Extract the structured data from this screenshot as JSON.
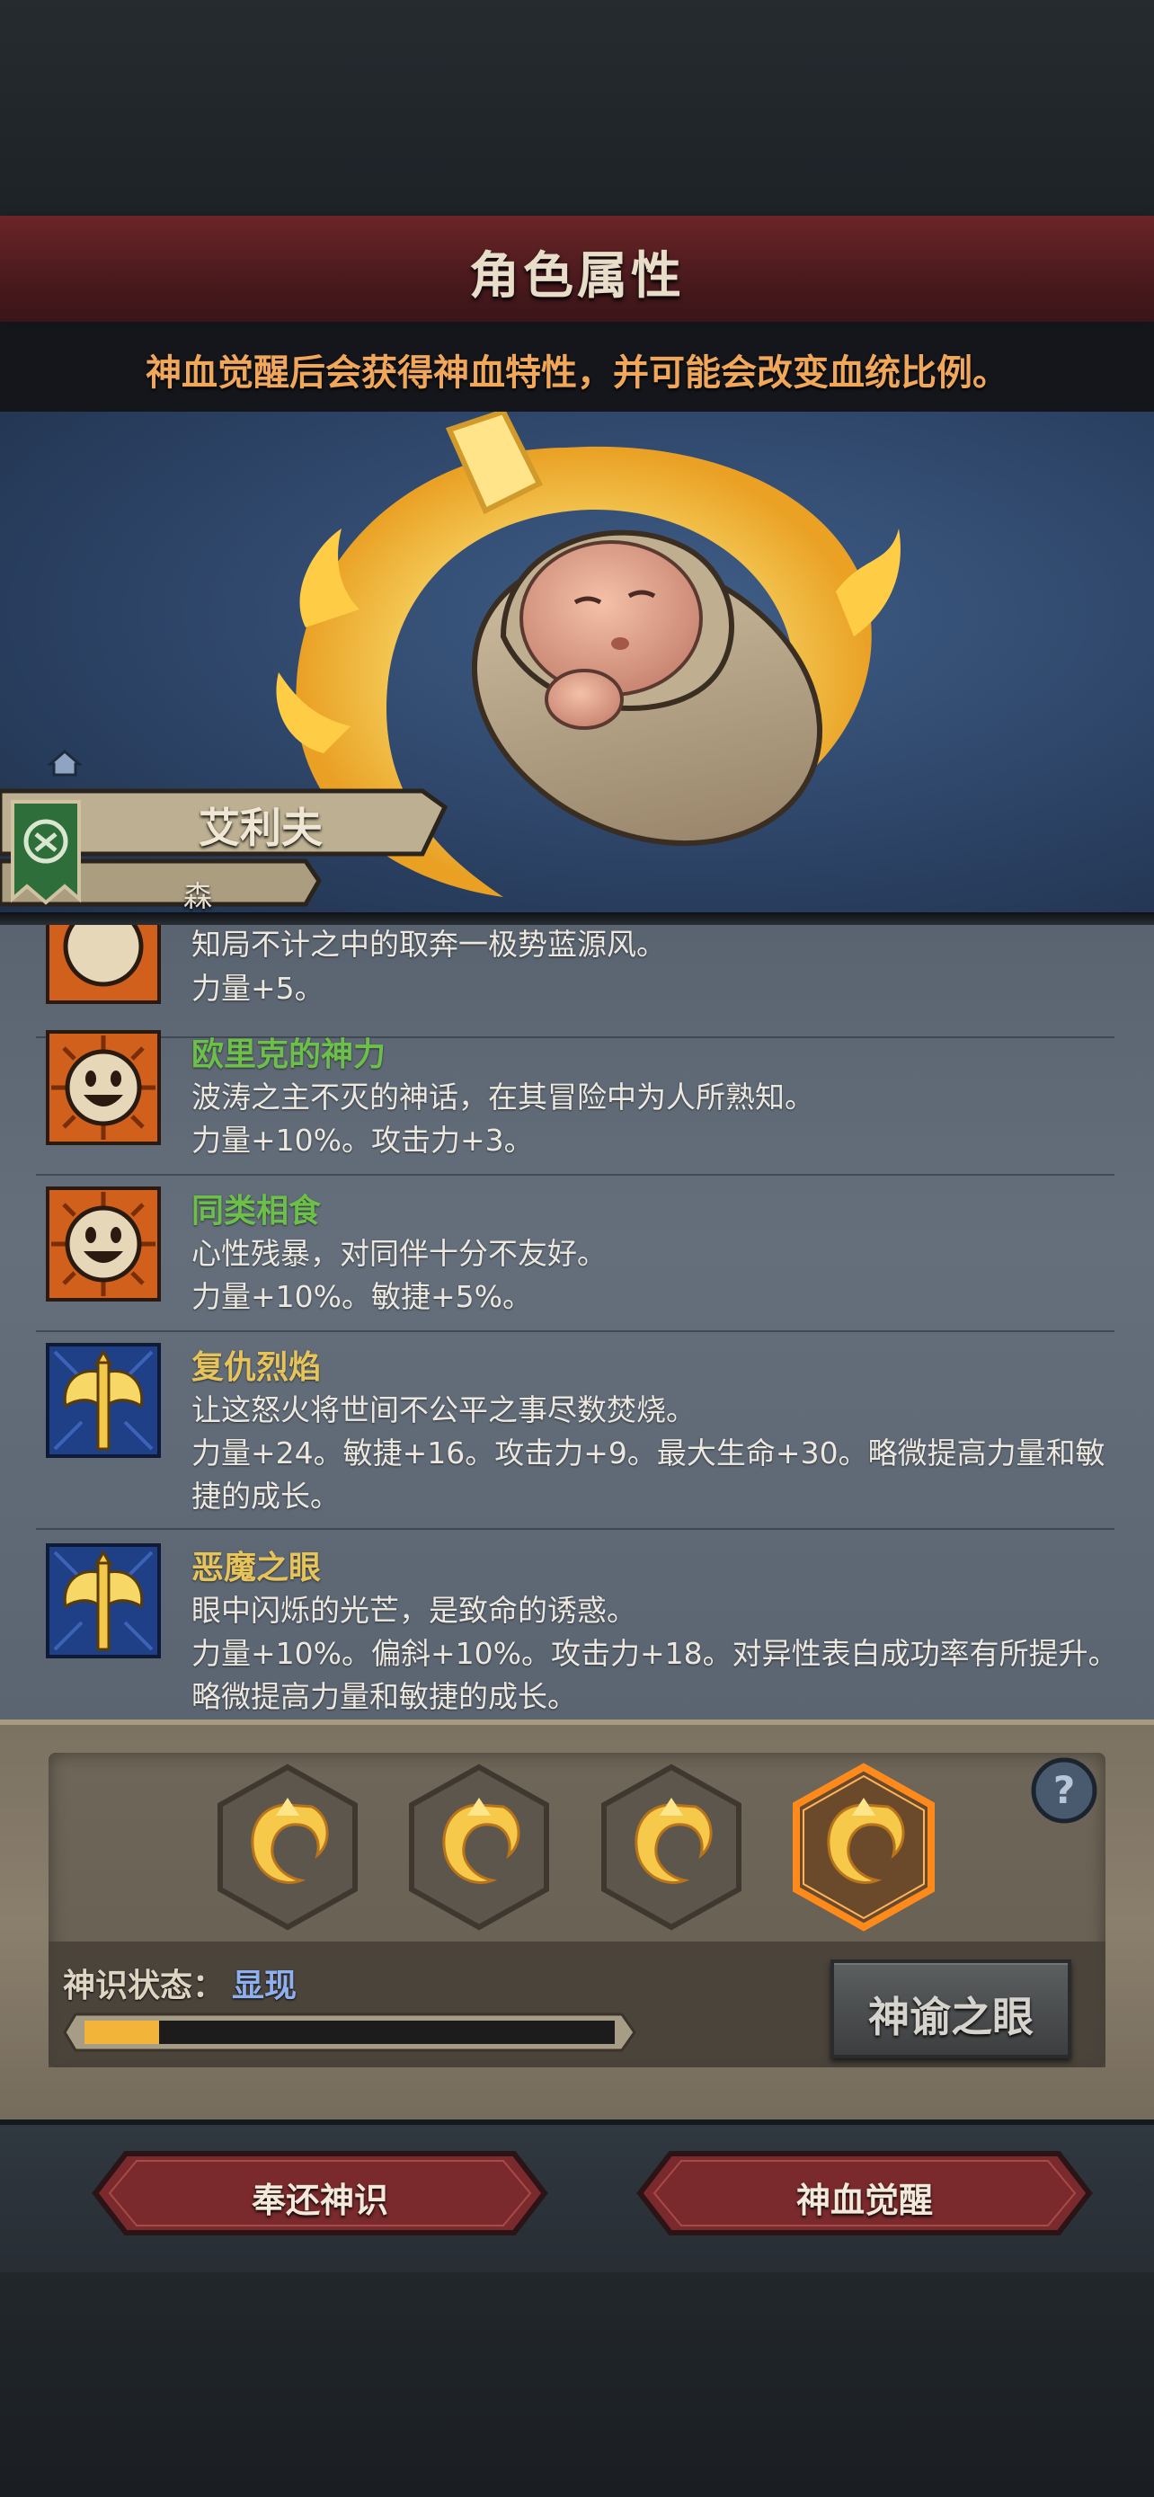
{
  "header": {
    "title": "角色属性",
    "subtitle": "神血觉醒后会获得神血特性，并可能会改变血统比例。"
  },
  "hero": {
    "name": "艾利夫",
    "tag": "森"
  },
  "traits": [
    {
      "name": "",
      "icon": "smile-face-icon",
      "lines": [
        "知局不计之中的取奔一极势蓝源风。",
        "力量+5。"
      ],
      "partial": true
    },
    {
      "name": "欧里克的神力",
      "icon": "smile-face-icon",
      "name_color": "#6cc04a",
      "lines": [
        "波涛之主不灭的神话，在其冒险中为人所熟知。",
        "力量+10%。攻击力+3。"
      ]
    },
    {
      "name": "同类相食",
      "icon": "smile-face-icon",
      "name_color": "#6cc04a",
      "lines": [
        "心性残暴，对同伴十分不友好。",
        "力量+10%。敏捷+5%。"
      ]
    },
    {
      "name": "复仇烈焰",
      "icon": "golden-axe-icon",
      "name_color": "#e6c45a",
      "lines": [
        "让这怒火将世间不公平之事尽数焚烧。",
        "力量+24。敏捷+16。攻击力+9。最大生命+30。略微提高力量和敏",
        "捷的成长。"
      ]
    },
    {
      "name": "恶魔之眼",
      "icon": "golden-axe-icon",
      "name_color": "#e6c45a",
      "lines": [
        "眼中闪烁的光芒，是致命的诱惑。",
        "力量+10%。偏斜+10%。攻击力+18。对异性表白成功率有所提升。",
        "略微提高力量和敏捷的成长。"
      ]
    }
  ],
  "awakening": {
    "slots": [
      {
        "icon": "divine-crest-icon",
        "selected": false
      },
      {
        "icon": "divine-crest-icon",
        "selected": false
      },
      {
        "icon": "divine-crest-icon",
        "selected": false
      },
      {
        "icon": "divine-crest-icon",
        "selected": true
      }
    ],
    "status_label": "神识状态：",
    "status_value": "显现",
    "progress": 0.14,
    "oracle_button": "神谕之眼",
    "accent_color": "#ff8a1c"
  },
  "actions": {
    "return_button": "奉还神识",
    "awaken_button": "神血觉醒"
  }
}
